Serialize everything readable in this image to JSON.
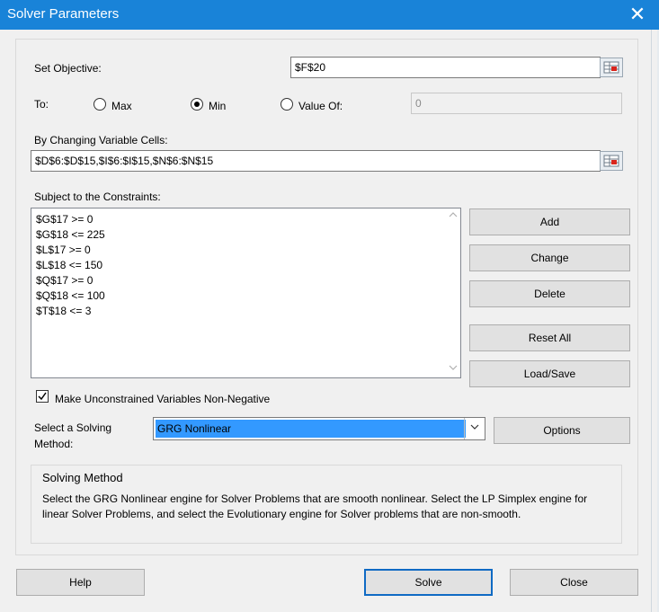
{
  "window": {
    "title": "Solver Parameters",
    "close_glyph": "✕"
  },
  "objective": {
    "label": "Set Objective:",
    "value": "$F$20"
  },
  "to": {
    "label": "To:",
    "options": [
      {
        "label": "Max",
        "selected": false
      },
      {
        "label": "Min",
        "selected": true
      },
      {
        "label": "Value Of:",
        "selected": false
      }
    ],
    "value_of": "0"
  },
  "variables": {
    "label": "By Changing Variable Cells:",
    "value": "$D$6:$D$15,$I$6:$I$15,$N$6:$N$15"
  },
  "constraints": {
    "label": "Subject to the Constraints:",
    "items": [
      "$G$17 >= 0",
      "$G$18 <= 225",
      "$L$17 >= 0",
      "$L$18 <= 150",
      "$Q$17 >= 0",
      "$Q$18 <= 100",
      "$T$18 <= 3"
    ]
  },
  "buttons": {
    "add": "Add",
    "change": "Change",
    "delete": "Delete",
    "reset_all": "Reset All",
    "load_save": "Load/Save",
    "options": "Options",
    "help": "Help",
    "solve": "Solve",
    "close": "Close"
  },
  "nonneg": {
    "label": "Make Unconstrained Variables Non-Negative",
    "checked": true
  },
  "method": {
    "label_line1": "Select a Solving",
    "label_line2": "Method:",
    "selected": "GRG Nonlinear"
  },
  "solving_method_group": {
    "title": "Solving Method",
    "description": "Select the GRG Nonlinear engine for Solver Problems that are smooth nonlinear. Select the LP Simplex engine for linear Solver Problems, and select the Evolutionary engine for Solver problems that are non-smooth."
  },
  "icons": {
    "range_selector": "range-select-icon",
    "scroll_up": "chevron-up-icon",
    "scroll_down": "chevron-down-icon",
    "dropdown": "chevron-down-icon"
  },
  "colors": {
    "titlebar": "#1983d8",
    "selection": "#3399ff",
    "default_button_border": "#0f6ac4"
  }
}
